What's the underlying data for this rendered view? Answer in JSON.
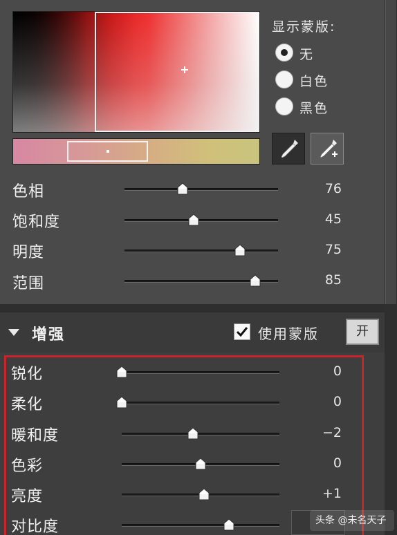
{
  "display_mask": {
    "title": "显示蒙版:",
    "options": [
      {
        "label": "无",
        "selected": true
      },
      {
        "label": "白色",
        "selected": false
      },
      {
        "label": "黑色",
        "selected": false
      }
    ]
  },
  "dropper_tools": [
    {
      "icon": "eyedropper-icon"
    },
    {
      "icon": "eyedropper-plus-icon"
    }
  ],
  "color_range": {
    "sliders": [
      {
        "label": "色相",
        "value": "76",
        "level": 0.38
      },
      {
        "label": "饱和度",
        "value": "45",
        "level": 0.45
      },
      {
        "label": "明度",
        "value": "75",
        "level": 0.75
      },
      {
        "label": "范围",
        "value": "85",
        "level": 0.85
      }
    ]
  },
  "enhance": {
    "title": "增强",
    "use_mask_label": "使用蒙版",
    "use_mask_checked": true,
    "toggle_label": "开",
    "sliders": [
      {
        "label": "锐化",
        "value": "0",
        "level": 0.0
      },
      {
        "label": "柔化",
        "value": "0",
        "level": 0.0
      },
      {
        "label": "暖和度",
        "value": "−2",
        "level": 0.45
      },
      {
        "label": "色彩",
        "value": "0",
        "level": 0.5
      },
      {
        "label": "亮度",
        "value": "+1",
        "level": 0.52
      },
      {
        "label": "对比度",
        "value": "",
        "level": 0.68
      }
    ]
  },
  "watermark": "头条 @未名天子",
  "colors": {
    "panel_bg": "#4a4a4a",
    "highlight_frame": "#c8242a"
  }
}
